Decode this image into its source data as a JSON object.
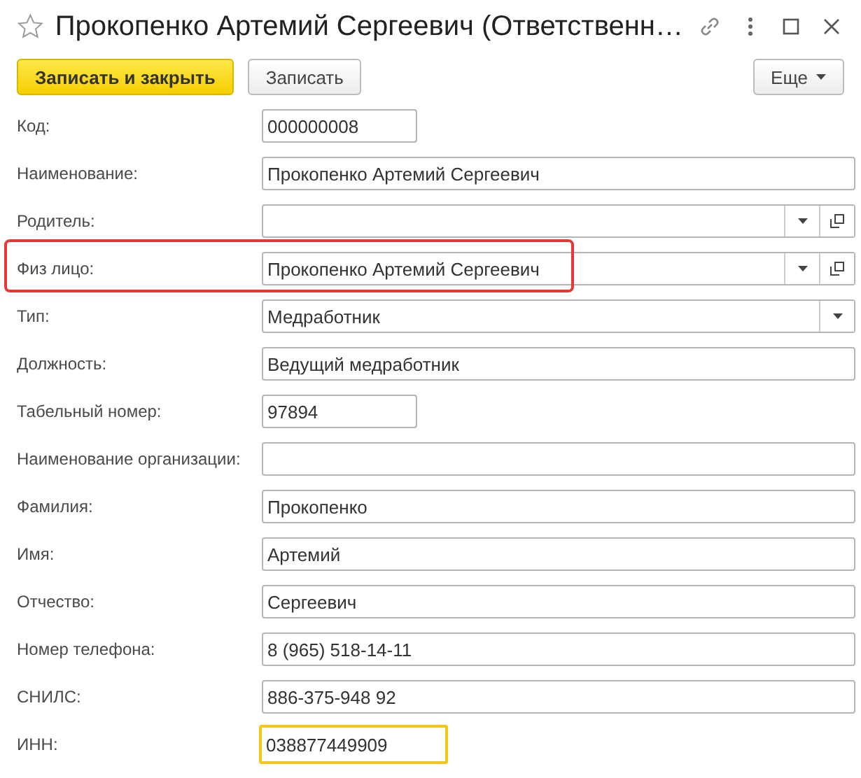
{
  "window": {
    "title": "Прокопенко Артемий Сергеевич (Ответственн…",
    "favorite": false
  },
  "toolbar": {
    "buttons": [
      {
        "label": "Записать и закрыть",
        "kind": "primary"
      },
      {
        "label": "Записать",
        "kind": "normal"
      }
    ],
    "more": {
      "label": "Еще"
    }
  },
  "fields": [
    {
      "label": "Код:",
      "value": "000000008",
      "kind": "short_text",
      "highlighted": false,
      "focused": false
    },
    {
      "label": "Наименование:",
      "value": "Прокопенко Артемий Сергеевич",
      "kind": "text",
      "highlighted": false,
      "focused": false
    },
    {
      "label": "Родитель:",
      "kind": "reference",
      "highlighted": false,
      "focused": false
    },
    {
      "label": "Физ лицо:",
      "value": "Прокопенко Артемий Сергеевич",
      "kind": "reference",
      "highlighted": true,
      "focused": false
    },
    {
      "label": "Тип:",
      "value": "Медработник",
      "kind": "choice",
      "highlighted": false,
      "focused": false
    },
    {
      "label": "Должность:",
      "value": "Ведущий медработник",
      "kind": "text",
      "highlighted": false,
      "focused": false
    },
    {
      "label": "Табельный номер:",
      "value": "97894",
      "kind": "short_text",
      "highlighted": false,
      "focused": false
    },
    {
      "label": "Наименование организации:",
      "kind": "text",
      "highlighted": false,
      "focused": false
    },
    {
      "label": "Фамилия:",
      "value": "Прокопенко",
      "kind": "text",
      "highlighted": false,
      "focused": false
    },
    {
      "label": "Имя:",
      "value": "Артемий",
      "kind": "text",
      "highlighted": false,
      "focused": false
    },
    {
      "label": "Отчество:",
      "value": "Сергеевич",
      "kind": "text",
      "highlighted": false,
      "focused": false
    },
    {
      "label": "Номер телефона:",
      "value": "8 (965) 518-14-11",
      "kind": "text",
      "highlighted": false,
      "focused": false
    },
    {
      "label": "СНИЛС:",
      "value": "886-375-948 92",
      "kind": "text",
      "highlighted": false,
      "focused": false
    },
    {
      "label": "ИНН:",
      "value": "038877449909",
      "kind": "short_text",
      "highlighted": false,
      "focused": true
    }
  ]
}
